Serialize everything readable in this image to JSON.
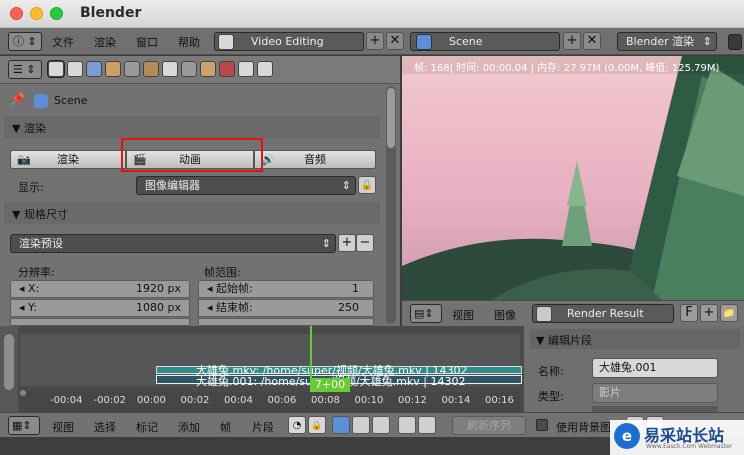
{
  "app": {
    "title": "Blender"
  },
  "menu": {
    "items": [
      "文件",
      "渲染",
      "窗口",
      "帮助"
    ],
    "screen_layout": "Video Editing",
    "scene": "Scene",
    "engine": "Blender 渲染"
  },
  "properties": {
    "scene_label": "Scene",
    "render_section": "渲染",
    "render_button": "渲染",
    "animation_button": "动画",
    "audio_button": "音频",
    "display_label": "显示:",
    "display_value": "图像编辑器",
    "dimensions_section": "规格尺寸",
    "render_presets": "渲染预设",
    "resolution_label": "分辨率:",
    "frame_range_label": "帧范围:",
    "res_x_label": "X:",
    "res_x_value": "1920 px",
    "res_y_label": "Y:",
    "res_y_value": "1080 px",
    "start_label": "起始帧:",
    "start_value": "1",
    "end_label": "结束帧:",
    "end_value": "250"
  },
  "viewer": {
    "status": "帧: 168| 时间: 00:00.04 | 内存: 27.97M (0.00M, 峰值: 125.79M)",
    "view_menu": "视图",
    "image_menu": "图像",
    "image_name": "Render Result",
    "fake_user": "F"
  },
  "sequencer": {
    "strip1": "大雄兔.mkv: /home/super/视频/大雄兔.mkv | 14302",
    "strip2": "大雄兔.001: /home/super/视频/大雄兔.mkv | 14302",
    "frame_indicator": "7+00",
    "ticks": [
      "-00:04",
      "-00:02",
      "00:00",
      "00:02",
      "00:04",
      "00:06",
      "00:08",
      "00:10",
      "00:12",
      "00:14",
      "00:16"
    ]
  },
  "strip_panel": {
    "section": "编辑片段",
    "name_label": "名称:",
    "name_value": "大雄兔.001",
    "type_label": "类型:",
    "type_value": "影片"
  },
  "bottom_bar": {
    "items": [
      "视图",
      "选择",
      "标记",
      "添加",
      "帧",
      "片段"
    ],
    "refresh": "刷新序列",
    "use_backdrop": "使用背景图"
  },
  "watermark": {
    "text": "易采站长站",
    "sub": "Www.Easck.Com Webmaster"
  },
  "colors": {
    "highlight_box": "#e01414",
    "frame_line": "#66cc33",
    "strip_teal": "#2f8c8c"
  }
}
